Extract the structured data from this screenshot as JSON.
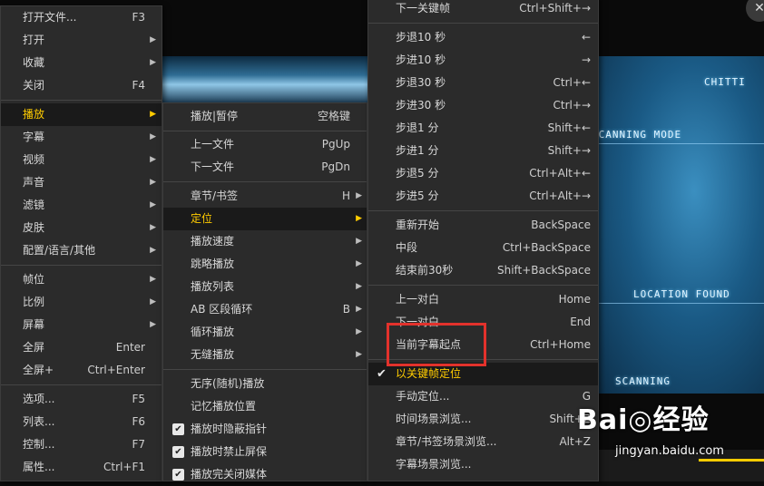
{
  "video": {
    "hud_top": "CHITTI",
    "hud_mode": "SCANNING MODE",
    "hud_location": "LOCATION FOUND",
    "hud_scanning": "SCANNING",
    "close": "✕"
  },
  "menu_main": {
    "items": [
      {
        "label": "打开文件...",
        "shortcut": "F3",
        "submenu": false
      },
      {
        "label": "打开",
        "shortcut": "",
        "submenu": true
      },
      {
        "label": "收藏",
        "shortcut": "",
        "submenu": true
      },
      {
        "label": "关闭",
        "shortcut": "F4",
        "submenu": false
      },
      {
        "label": "播放",
        "shortcut": "",
        "submenu": true,
        "highlighted": true
      },
      {
        "label": "字幕",
        "shortcut": "",
        "submenu": true
      },
      {
        "label": "视频",
        "shortcut": "",
        "submenu": true
      },
      {
        "label": "声音",
        "shortcut": "",
        "submenu": true
      },
      {
        "label": "滤镜",
        "shortcut": "",
        "submenu": true
      },
      {
        "label": "皮肤",
        "shortcut": "",
        "submenu": true
      },
      {
        "label": "配置/语言/其他",
        "shortcut": "",
        "submenu": true
      },
      {
        "label": "帧位",
        "shortcut": "",
        "submenu": true
      },
      {
        "label": "比例",
        "shortcut": "",
        "submenu": true
      },
      {
        "label": "屏幕",
        "shortcut": "",
        "submenu": true
      },
      {
        "label": "全屏",
        "shortcut": "Enter",
        "submenu": false
      },
      {
        "label": "全屏+",
        "shortcut": "Ctrl+Enter",
        "submenu": false
      },
      {
        "label": "选项...",
        "shortcut": "F5",
        "submenu": false
      },
      {
        "label": "列表...",
        "shortcut": "F6",
        "submenu": false
      },
      {
        "label": "控制...",
        "shortcut": "F7",
        "submenu": false
      },
      {
        "label": "属性...",
        "shortcut": "Ctrl+F1",
        "submenu": false
      }
    ]
  },
  "menu_play": {
    "items": [
      {
        "label": "播放|暂停",
        "shortcut": "空格键"
      },
      {
        "label": "上一文件",
        "shortcut": "PgUp"
      },
      {
        "label": "下一文件",
        "shortcut": "PgDn"
      },
      {
        "label": "章节/书签",
        "shortcut": "H"
      },
      {
        "label": "定位",
        "shortcut": ""
      },
      {
        "label": "播放速度",
        "shortcut": ""
      },
      {
        "label": "跳略播放",
        "shortcut": ""
      },
      {
        "label": "播放列表",
        "shortcut": ""
      },
      {
        "label": "AB 区段循环",
        "shortcut": "B"
      },
      {
        "label": "循环播放",
        "shortcut": ""
      },
      {
        "label": "无缝播放",
        "shortcut": ""
      },
      {
        "label": "无序(随机)播放",
        "shortcut": ""
      },
      {
        "label": "记忆播放位置",
        "shortcut": ""
      },
      {
        "label": "播放时隐蔽指针",
        "shortcut": ""
      },
      {
        "label": "播放时禁止屏保",
        "shortcut": ""
      },
      {
        "label": "播放完关闭媒体",
        "shortcut": ""
      }
    ]
  },
  "menu_seek": {
    "items": [
      {
        "label": "下一关键帧",
        "shortcut": "Ctrl+Shift+→"
      },
      {
        "label": "步退10 秒",
        "shortcut": "←"
      },
      {
        "label": "步进10 秒",
        "shortcut": "→"
      },
      {
        "label": "步退30 秒",
        "shortcut": "Ctrl+←"
      },
      {
        "label": "步进30 秒",
        "shortcut": "Ctrl+→"
      },
      {
        "label": "步退1 分",
        "shortcut": "Shift+←"
      },
      {
        "label": "步进1 分",
        "shortcut": "Shift+→"
      },
      {
        "label": "步退5 分",
        "shortcut": "Ctrl+Alt+←"
      },
      {
        "label": "步进5 分",
        "shortcut": "Ctrl+Alt+→"
      },
      {
        "label": "重新开始",
        "shortcut": "BackSpace"
      },
      {
        "label": "中段",
        "shortcut": "Ctrl+BackSpace"
      },
      {
        "label": "结束前30秒",
        "shortcut": "Shift+BackSpace"
      },
      {
        "label": "上一对白",
        "shortcut": "Home"
      },
      {
        "label": "下一对白",
        "shortcut": "End"
      },
      {
        "label": "当前字幕起点",
        "shortcut": "Ctrl+Home"
      },
      {
        "label": "以关键帧定位",
        "shortcut": ""
      },
      {
        "label": "手动定位...",
        "shortcut": "G"
      },
      {
        "label": "时间场景浏览...",
        "shortcut": "Shift+Z"
      },
      {
        "label": "章节/书签场景浏览...",
        "shortcut": "Alt+Z"
      },
      {
        "label": "字幕场景浏览...",
        "shortcut": ""
      }
    ]
  },
  "watermark": {
    "main": "Bai◎经验",
    "sub": "jingyan.baidu.com"
  },
  "colors": {
    "highlight_text": "#ffcc00",
    "annotation_box": "#e3322c",
    "menu_bg": "#2b2b2b"
  }
}
